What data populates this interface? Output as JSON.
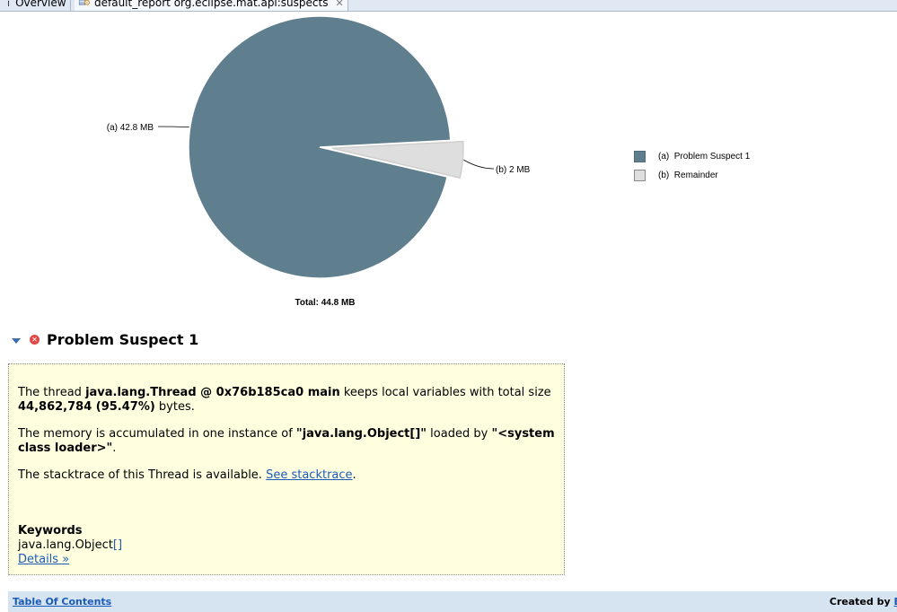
{
  "tabs": [
    {
      "label": "Overview",
      "icon": "info-icon"
    },
    {
      "label": "default_report  org.eclipse.mat.api:suspects",
      "icon": "report-icon"
    }
  ],
  "chart_data": {
    "type": "pie",
    "slices": [
      {
        "key": "(a)",
        "label": "Problem Suspect 1",
        "value": 42.8,
        "value_label": "42.8 MB",
        "color": "#607f8e"
      },
      {
        "key": "(b)",
        "label": "Remainder",
        "value": 2,
        "value_label": "2 MB",
        "color": "#dedede"
      }
    ],
    "total_label": "Total: 44.8 MB",
    "legend_position": "right"
  },
  "section": {
    "title": "Problem Suspect 1",
    "p1_pre": "The thread ",
    "p1_thread": "java.lang.Thread @ 0x76b185ca0 main",
    "p1_mid": " keeps local variables with total size ",
    "p1_size": "44,862,784 (95.47%)",
    "p1_post": " bytes.",
    "p2_pre": "The memory is accumulated in one instance of ",
    "p2_class": "\"java.lang.Object[]\"",
    "p2_mid": " loaded by ",
    "p2_loader": "\"<system class loader>\"",
    "p2_post": ".",
    "p3_pre": "The stacktrace of this Thread is available. ",
    "p3_link": "See stacktrace",
    "p3_post": ".",
    "keywords_title": "Keywords",
    "keyword_main": "java.lang.Object",
    "keyword_suffix": "[]",
    "details_link": "Details »"
  },
  "footer": {
    "toc": "Table Of Contents",
    "created": "Created by ",
    "created_link": "E"
  },
  "colors": {
    "suspect": "#607f8e",
    "remainder": "#dedede",
    "box_bg": "#ffffe0",
    "link": "#1a5bb8",
    "footer_bg": "#d6e3f0"
  }
}
